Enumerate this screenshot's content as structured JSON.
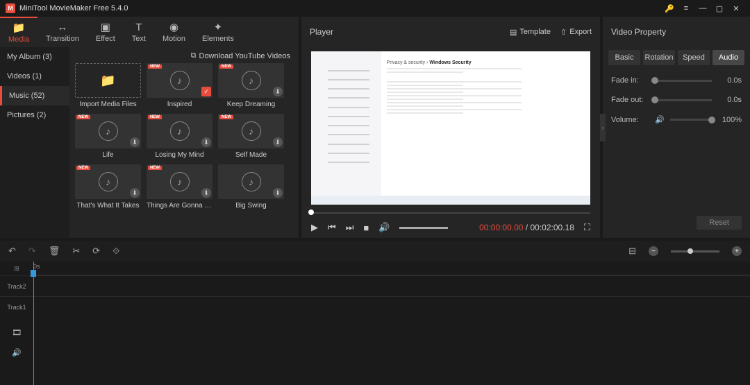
{
  "app": {
    "title": "MiniTool MovieMaker Free 5.4.0"
  },
  "ribbon": [
    {
      "label": "Media",
      "active": true
    },
    {
      "label": "Transition"
    },
    {
      "label": "Effect"
    },
    {
      "label": "Text"
    },
    {
      "label": "Motion"
    },
    {
      "label": "Elements"
    }
  ],
  "sidebar": {
    "items": [
      {
        "label": "My Album (3)"
      },
      {
        "label": "Videos (1)"
      },
      {
        "label": "Music (52)",
        "active": true
      },
      {
        "label": "Pictures (2)"
      }
    ]
  },
  "download_link": "Download YouTube Videos",
  "media_rows": [
    [
      {
        "label": "Import Media Files",
        "import": true
      },
      {
        "label": "Inspired",
        "new": true,
        "selected": true
      },
      {
        "label": "Keep Dreaming",
        "new": true,
        "dl": true
      }
    ],
    [
      {
        "label": "Life",
        "new": true,
        "dl": true
      },
      {
        "label": "Losing My Mind",
        "new": true,
        "dl": true
      },
      {
        "label": "Self Made",
        "new": true,
        "dl": true
      }
    ],
    [
      {
        "label": "That's What It Takes",
        "new": true,
        "dl": true
      },
      {
        "label": "Things Are Gonna Ge...",
        "new": true,
        "dl": true
      },
      {
        "label": "Big Swing",
        "dl": true
      }
    ]
  ],
  "player": {
    "title": "Player",
    "template": "Template",
    "export": "Export",
    "current": "00:00:00.00",
    "sep": " / ",
    "duration": "00:02:00.18",
    "preview": {
      "crumb_left": "Privacy & security",
      "crumb_sep": "  ›  ",
      "crumb_right": "Windows Security"
    }
  },
  "props": {
    "title": "Video Property",
    "tabs": [
      "Basic",
      "Rotation",
      "Speed",
      "Audio"
    ],
    "active_tab": 3,
    "rows": [
      {
        "label": "Fade in:",
        "value": "0.0s",
        "pos": 0
      },
      {
        "label": "Fade out:",
        "value": "0.0s",
        "pos": 0
      },
      {
        "label": "Volume:",
        "value": "100%",
        "pos": 100,
        "icon": true
      }
    ],
    "reset": "Reset"
  },
  "timeline": {
    "start_label": "0s",
    "tracks": [
      "Track2",
      "Track1"
    ]
  }
}
